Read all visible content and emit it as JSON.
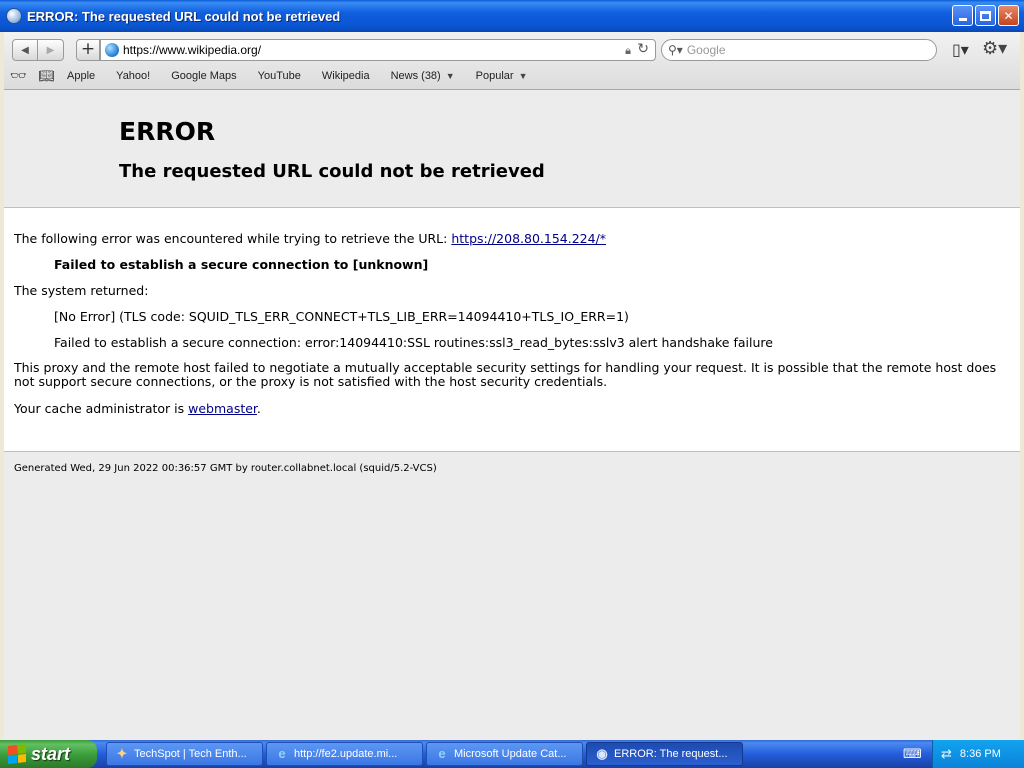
{
  "window": {
    "title": "ERROR: The requested URL could not be retrieved"
  },
  "toolbar": {
    "url": "https://www.wikipedia.org/",
    "search_placeholder": "Google"
  },
  "bookmarks": [
    {
      "label": "Apple"
    },
    {
      "label": "Yahoo!"
    },
    {
      "label": "Google Maps"
    },
    {
      "label": "YouTube"
    },
    {
      "label": "Wikipedia"
    },
    {
      "label": "News (38)"
    },
    {
      "label": "Popular"
    }
  ],
  "page": {
    "heading": "ERROR",
    "subheading": "The requested URL could not be retrieved",
    "intro": "The following error was encountered while trying to retrieve the URL:",
    "intro_link": "https://208.80.154.224/*",
    "error_line": "Failed to establish a secure connection to [unknown]",
    "system_returned": "The system returned:",
    "no_error": "[No Error] (TLS code: SQUID_TLS_ERR_CONNECT+TLS_LIB_ERR=14094410+TLS_IO_ERR=1)",
    "ssl_error": "Failed to establish a secure connection: error:14094410:SSL routines:ssl3_read_bytes:sslv3 alert handshake failure",
    "explanation": "This proxy and the remote host failed to negotiate a mutually acceptable security settings for handling your request. It is possible that the remote host does not support secure connections, or the proxy is not satisfied with the host security credentials.",
    "admin_prefix": "Your cache administrator is",
    "admin_link": "webmaster",
    "admin_suffix": ".",
    "footer": "Generated Wed, 29 Jun 2022 00:36:57 GMT by router.collabnet.local (squid/5.2-VCS)"
  },
  "taskbar": {
    "start_label": "start",
    "tasks": [
      {
        "label": "TechSpot | Tech Enth..."
      },
      {
        "label": "http://fe2.update.mi..."
      },
      {
        "label": "Microsoft Update Cat..."
      },
      {
        "label": "ERROR: The request..."
      }
    ],
    "clock": "8:36 PM"
  }
}
